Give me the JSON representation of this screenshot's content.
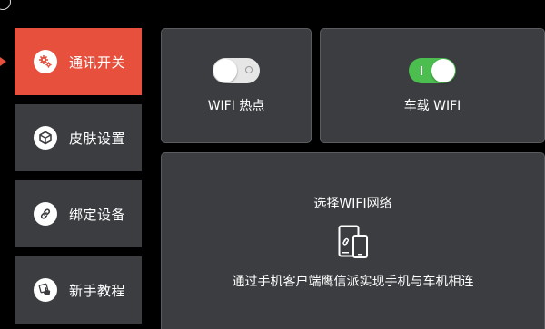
{
  "sidebar": {
    "items": [
      {
        "label": "通讯开关",
        "icon": "gears-icon",
        "active": true
      },
      {
        "label": "皮肤设置",
        "icon": "cube-icon",
        "active": false
      },
      {
        "label": "绑定设备",
        "icon": "link-icon",
        "active": false
      },
      {
        "label": "新手教程",
        "icon": "hand-tap-icon",
        "active": false
      }
    ]
  },
  "main": {
    "hotspot": {
      "label": "WIFI 热点",
      "state": "off"
    },
    "car_wifi": {
      "label": "车载 WIFI",
      "state": "on"
    },
    "wifi_network": {
      "title": "选择WIFI网络",
      "description": "通过手机客户端鹰信派实现手机与车机相连",
      "icon": "phone-tablet-link-icon"
    }
  },
  "colors": {
    "background": "#000000",
    "panel": "#3b3d40",
    "accent": "#e8503e",
    "toggle_on": "#4cbd4f",
    "toggle_off": "#e6e6e6"
  }
}
